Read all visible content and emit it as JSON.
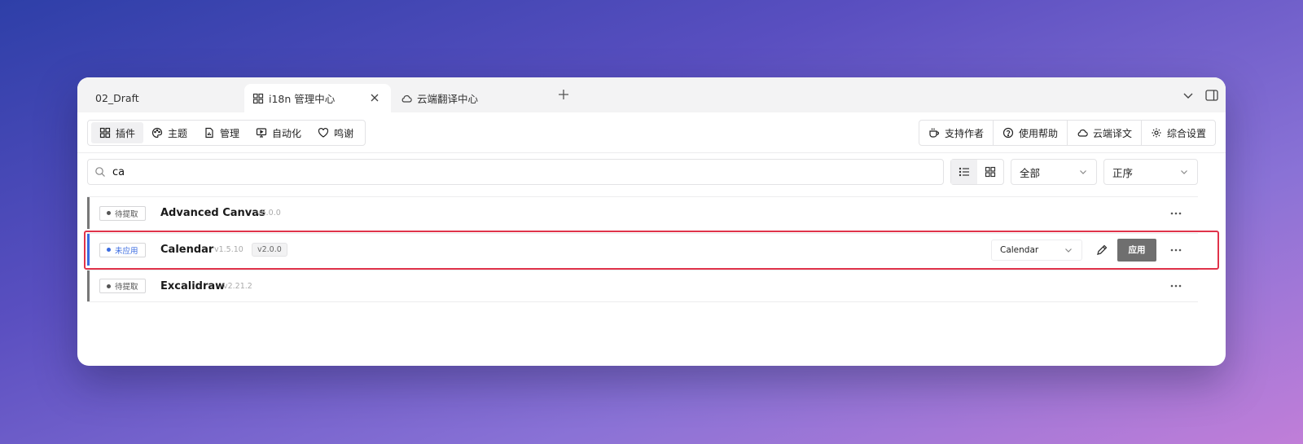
{
  "tabs": [
    {
      "label": "02_Draft"
    },
    {
      "label": "i18n 管理中心"
    },
    {
      "label": "云端翻译中心"
    }
  ],
  "nav": {
    "items": [
      {
        "label": "插件",
        "icon": "grid-icon"
      },
      {
        "label": "主题",
        "icon": "palette-icon"
      },
      {
        "label": "管理",
        "icon": "file-chart-icon"
      },
      {
        "label": "自动化",
        "icon": "monitor-play-icon"
      },
      {
        "label": "鸣谢",
        "icon": "heart-icon"
      }
    ],
    "right": [
      {
        "label": "支持作者",
        "icon": "coffee-icon"
      },
      {
        "label": "使用帮助",
        "icon": "help-circle-icon"
      },
      {
        "label": "云端译文",
        "icon": "cloud-icon"
      },
      {
        "label": "综合设置",
        "icon": "gear-icon"
      }
    ]
  },
  "search": {
    "value": "ca"
  },
  "filters": {
    "status": "全部",
    "order": "正序"
  },
  "plugins": [
    {
      "status": "待提取",
      "name": "Advanced Canvas",
      "version": "v6.0.0"
    },
    {
      "status": "未应用",
      "name": "Calendar",
      "version": "v1.5.10",
      "translation_version": "v2.0.0",
      "selected_translation": "Calendar",
      "apply_label": "应用"
    },
    {
      "status": "待提取",
      "name": "Excalidraw",
      "version": "v2.21.2"
    }
  ],
  "colors": {
    "accent": "#3a6be0",
    "highlight": "#e0334a"
  }
}
